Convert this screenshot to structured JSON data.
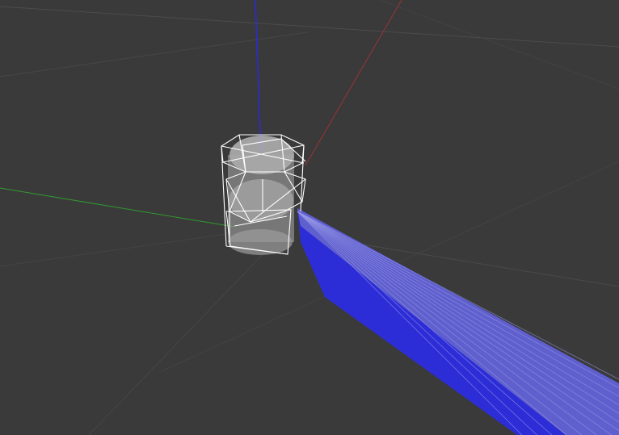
{
  "viewport": {
    "background": "#3a3a3a"
  },
  "colors": {
    "grid": "#505050",
    "axis_x": "#8a2e2e",
    "axis_y": "#2e8a2e",
    "axis_z": "#2020cc",
    "wireframe": "#ffffff",
    "cylinder_fill": "#b8b8b8",
    "beam_dark": "#2a2ad8",
    "beam_light": "#6a6ad2"
  },
  "scene": {
    "objects": [
      {
        "name": "cylinder",
        "style": "semi-transparent"
      },
      {
        "name": "bounding-wireframe",
        "style": "wireframe"
      },
      {
        "name": "sensor-beam",
        "style": "fan-rays"
      }
    ],
    "axes": [
      "x-axis",
      "y-axis",
      "z-axis"
    ],
    "grid": true
  }
}
